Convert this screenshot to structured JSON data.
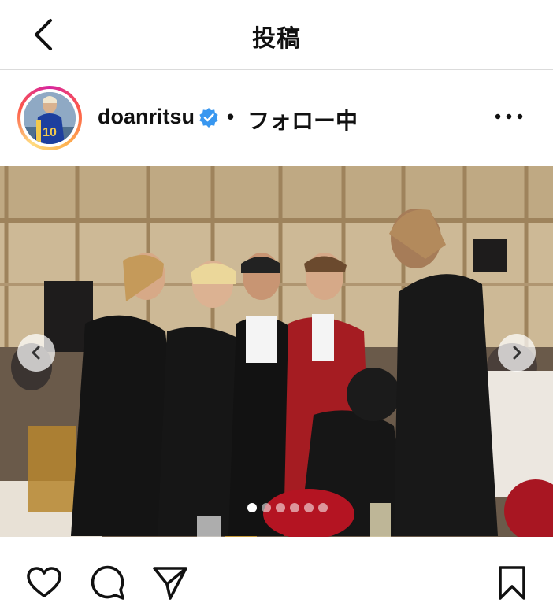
{
  "header": {
    "title": "投稿"
  },
  "post": {
    "username": "doanritsu",
    "separator": "•",
    "follow_state": "フォロー中",
    "avatar_jersey_number": "10"
  },
  "carousel": {
    "total": 6,
    "active_index": 0
  },
  "colors": {
    "verified_blue": "#3897f0",
    "border": "#dbdbdb",
    "icon": "#111111"
  },
  "icons": {
    "back": "chevron-left-icon",
    "verified": "verified-badge-icon",
    "more": "more-horizontal-icon",
    "like": "heart-icon",
    "comment": "comment-bubble-icon",
    "share": "send-paper-plane-icon",
    "save": "bookmark-icon"
  }
}
